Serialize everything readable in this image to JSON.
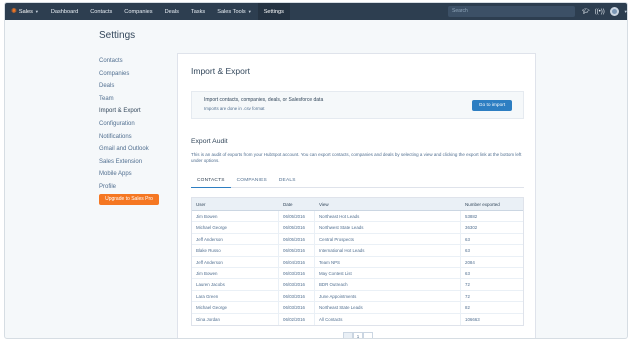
{
  "topnav": {
    "brand": "Sales",
    "items": [
      {
        "label": "Dashboard"
      },
      {
        "label": "Contacts"
      },
      {
        "label": "Companies"
      },
      {
        "label": "Deals"
      },
      {
        "label": "Tasks"
      },
      {
        "label": "Sales Tools"
      },
      {
        "label": "Settings"
      }
    ],
    "active": "Settings",
    "search_placeholder": "Search",
    "icons": [
      "graduation-cap-icon",
      "broadcast-icon",
      "avatar"
    ]
  },
  "settings": {
    "title": "Settings",
    "nav": [
      "Contacts",
      "Companies",
      "Deals",
      "Team",
      "Import & Export",
      "Configuration",
      "Notifications",
      "Gmail and Outlook",
      "Sales Extension",
      "Mobile Apps",
      "Profile"
    ],
    "active": "Import & Export",
    "upgrade_label": "Upgrade to Sales Pro"
  },
  "main": {
    "title": "Import & Export",
    "import": {
      "heading": "Import contacts, companies, deals, or Salesforce data",
      "sub": "Imports are done in .csv format",
      "button": "Go to import"
    },
    "audit": {
      "title": "Export Audit",
      "description": "This is an audit of exports from your HubSpot account. You can export contacts, companies and deals by selecting a view and clicking the export link at the bottom left under options.",
      "tabs": [
        "CONTACTS",
        "COMPANIES",
        "DEALS"
      ],
      "active_tab": "CONTACTS",
      "columns": [
        "User",
        "Date",
        "View",
        "Number exported"
      ],
      "rows": [
        [
          "Jim Bowen",
          "06/05/2016",
          "Northeast Hot Leads",
          "53882"
        ],
        [
          "Michael George",
          "06/05/2016",
          "Northwest State Leads",
          "36302"
        ],
        [
          "Jeff Anderson",
          "06/05/2016",
          "Central Prospects",
          "63"
        ],
        [
          "Blake Russo",
          "06/05/2016",
          "International Hot Leads",
          "63"
        ],
        [
          "Jeff Anderson",
          "06/04/2016",
          "Team NPS",
          "2084"
        ],
        [
          "Jim Bowen",
          "06/03/2016",
          "May Contest List",
          "63"
        ],
        [
          "Lauren Jacobs",
          "06/03/2016",
          "BDR Outreach",
          "72"
        ],
        [
          "Lara Green",
          "06/03/2016",
          "June Appointments",
          "72"
        ],
        [
          "Michael George",
          "06/03/2016",
          "Northeast State Leads",
          "82"
        ],
        [
          "Gina Jordan",
          "06/02/2016",
          "All Contacts",
          "106663"
        ]
      ],
      "pagination": {
        "current": "1"
      }
    }
  },
  "colors": {
    "nav_bg": "#2d3e50",
    "accent": "#2d7ec2",
    "upgrade": "#f57722"
  }
}
